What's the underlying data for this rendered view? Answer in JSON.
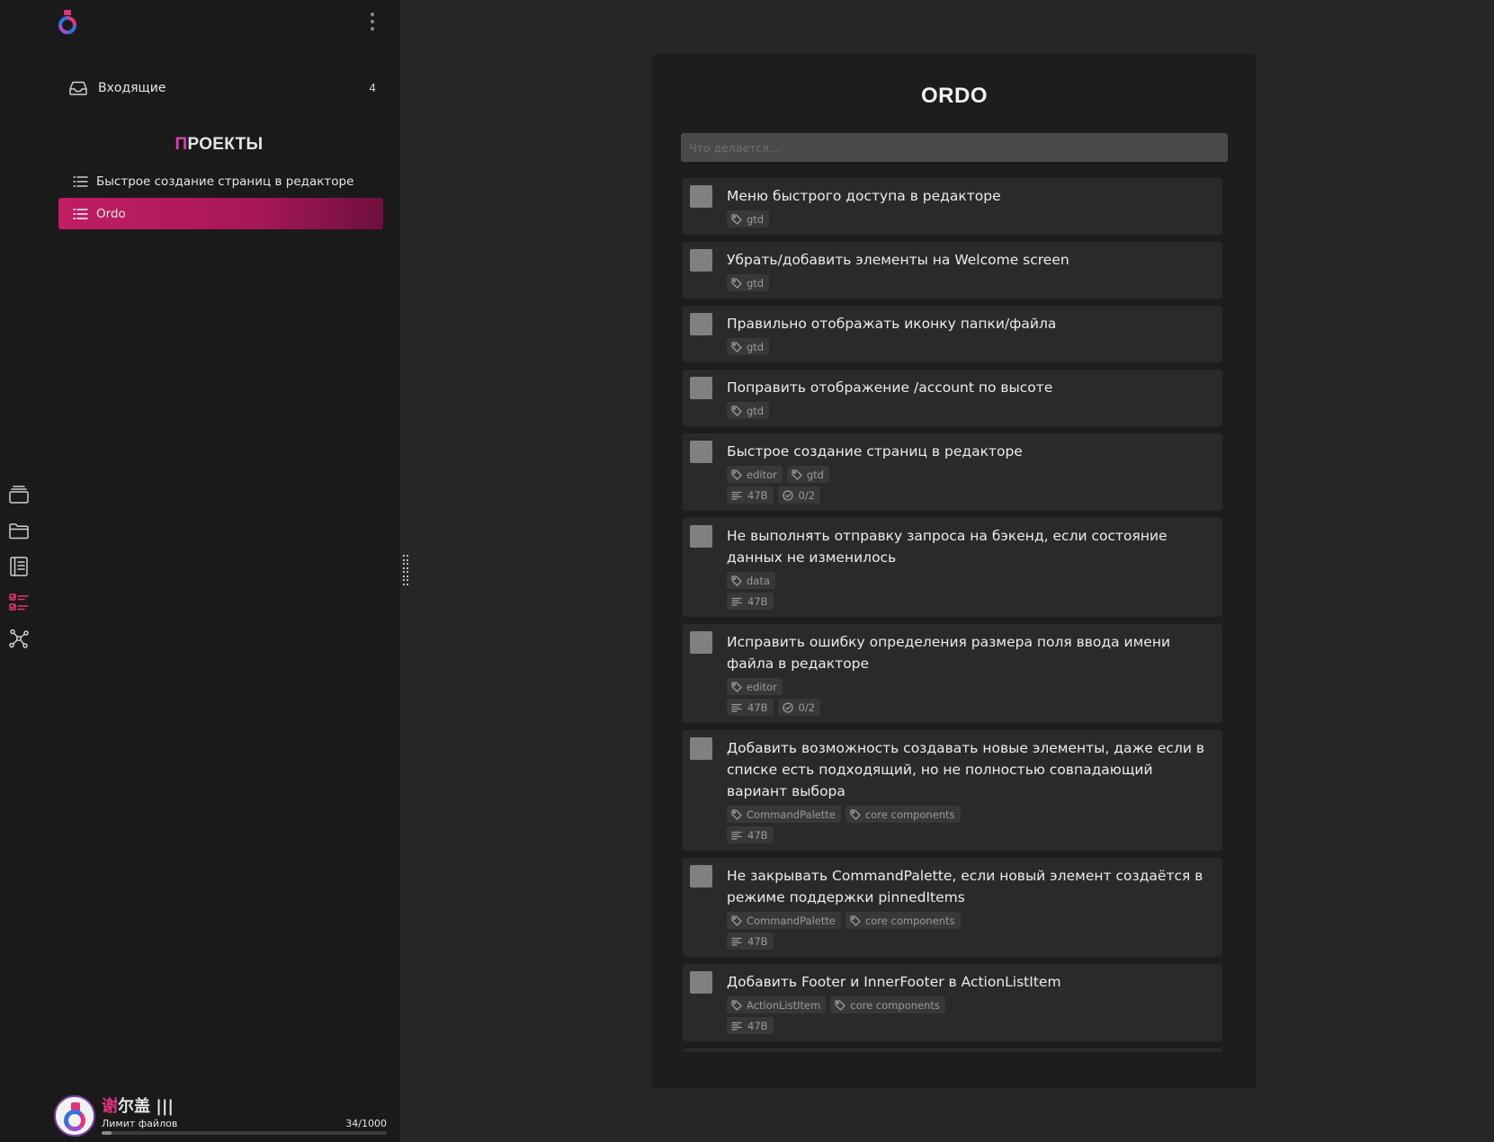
{
  "sidebar": {
    "inbox": {
      "label": "Входящие",
      "count": "4"
    },
    "projects_title_first": "П",
    "projects_title_rest": "РОЕКТЫ",
    "projects": [
      {
        "label": "Быстрое создание страниц в редакторе",
        "active": false
      },
      {
        "label": "Ordo",
        "active": true
      }
    ]
  },
  "rail": {
    "icons": [
      "stack-icon",
      "folder-icon",
      "notebook-icon",
      "checklist-icon",
      "graph-icon"
    ],
    "active": "checklist-icon"
  },
  "user": {
    "name_accent": "谢",
    "name_rest": "尔盖 |||",
    "limit_label": "Лимит файлов",
    "limit_count": "34/1000",
    "limit_fraction": 0.034
  },
  "main": {
    "title": "ORDO",
    "search_placeholder": "Что делается...",
    "tasks": [
      {
        "title": "Меню быстрого доступа в редакторе",
        "tags": [
          "gtd"
        ],
        "size": null,
        "checklist": null
      },
      {
        "title": "Убрать/добавить элементы на Welcome screen",
        "tags": [
          "gtd"
        ],
        "size": null,
        "checklist": null
      },
      {
        "title": "Правильно отображать иконку папки/файла",
        "tags": [
          "gtd"
        ],
        "size": null,
        "checklist": null
      },
      {
        "title": "Поправить отображение /account по высоте",
        "tags": [
          "gtd"
        ],
        "size": null,
        "checklist": null
      },
      {
        "title": "Быстрое создание страниц в редакторе",
        "tags": [
          "editor",
          "gtd"
        ],
        "size": "47B",
        "checklist": "0/2"
      },
      {
        "title": "Не выполнять отправку запроса на бэкенд, если состояние данных не изменилось",
        "tags": [
          "data"
        ],
        "size": "47B",
        "checklist": null
      },
      {
        "title": "Исправить ошибку определения размера поля ввода имени файла в редакторе",
        "tags": [
          "editor"
        ],
        "size": "47B",
        "checklist": "0/2"
      },
      {
        "title": "Добавить возможность создавать новые элементы, даже если в списке есть подходящий, но не полностью совпадающий вариант выбора",
        "tags": [
          "CommandPalette",
          "core components"
        ],
        "size": "47B",
        "checklist": null
      },
      {
        "title": "Не закрывать CommandPalette, если новый элемент создаётся в режиме поддержки pinnedItems",
        "tags": [
          "CommandPalette",
          "core components"
        ],
        "size": "47B",
        "checklist": null
      },
      {
        "title": "Добавить Footer и InnerFooter в ActionListItem",
        "tags": [
          "ActionListItem",
          "core components"
        ],
        "size": "47B",
        "checklist": null
      }
    ]
  },
  "colors": {
    "accent": "#e0347d",
    "active_gradient_start": "#c01d63",
    "active_gradient_end": "#6e0f3d",
    "background": "#262626",
    "sidebar": "#1a1a1a",
    "card": "#1d1d1d",
    "task": "#2a2a2a"
  }
}
